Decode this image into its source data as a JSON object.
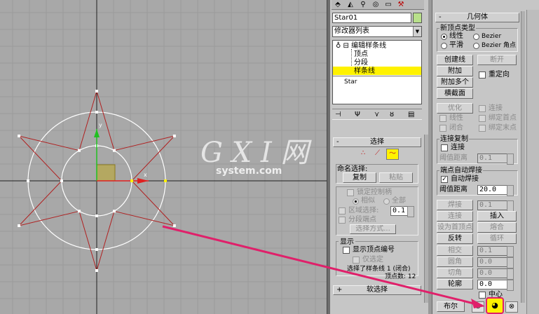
{
  "modifier_panel": {
    "object_name": "Star01",
    "color_swatch": "#b8e08a",
    "modifier_list_label": "修改器列表",
    "stack": {
      "root": "编辑样条线",
      "sub_items": [
        "顶点",
        "分段",
        "样条线"
      ],
      "selected_item": "样条线",
      "base": "Star"
    }
  },
  "selection_rollout": {
    "title": "选择",
    "named_selection_label": "命名选择:",
    "copy_button": "复制",
    "paste_button": "粘贴",
    "lock_handles": "锁定控制柄",
    "similar": "相似",
    "all": "全部",
    "area_select": "区域选择:",
    "area_value": "0.1",
    "segment_end": "分段端点",
    "select_by_button": "选择方式...",
    "display_label": "显示",
    "show_vertex_numbers": "显示顶点编号",
    "selected_only": "仅选定",
    "status_line1": "选择了样条线 1 (闭合)",
    "status_line2": "顶点数: 12"
  },
  "soft_selection_rollout": {
    "title": "软选择"
  },
  "geometry_rollout": {
    "title": "几何体",
    "new_vertex_type_label": "新顶点类型",
    "linear": "线性",
    "bezier": "Bezier",
    "smooth": "平滑",
    "bezier_corner": "Bezier 角点",
    "create_line": "创建线",
    "break": "断开",
    "attach": "附加",
    "reorient": "重定向",
    "attach_multiple": "附加多个",
    "cross_section": "横截面",
    "refine": "优化",
    "connect": "连接",
    "linear2": "线性",
    "bind_first": "绑定首点",
    "closed": "闭合",
    "bind_last": "绑定末点",
    "connect_copy_label": "连接复制",
    "connect_chk": "连接",
    "threshold_label": "阈值距离",
    "threshold_value": "0.1",
    "end_autoweld_label": "端点自动焊接",
    "auto_weld": "自动焊接",
    "threshold2_label": "阈值距离",
    "threshold2_value": "20.0",
    "weld": "焊接",
    "weld_value": "0.1",
    "connect_btn": "连接",
    "insert": "插入",
    "make_first": "设为首顶点",
    "fuse": "熔合",
    "reverse": "反转",
    "cycle": "循环",
    "cross_insert": "相交",
    "cross_value": "0.1",
    "fillet": "圆角",
    "fillet_value": "0.0",
    "chamfer": "切角",
    "chamfer_value": "0.0",
    "outline": "轮廓",
    "outline_value": "0.0",
    "center": "中心",
    "boolean": "布尔"
  },
  "watermark": {
    "brand": "G X I 网",
    "domain": "system.com"
  },
  "colors": {
    "viewport_bg": "#a8a8a8",
    "grid_line": "#9a9a9a",
    "shape_line": "#b02020",
    "selected_spline": "#ffffff",
    "highlight_yellow": "#fff200",
    "arrow_pink": "#e0206a"
  }
}
